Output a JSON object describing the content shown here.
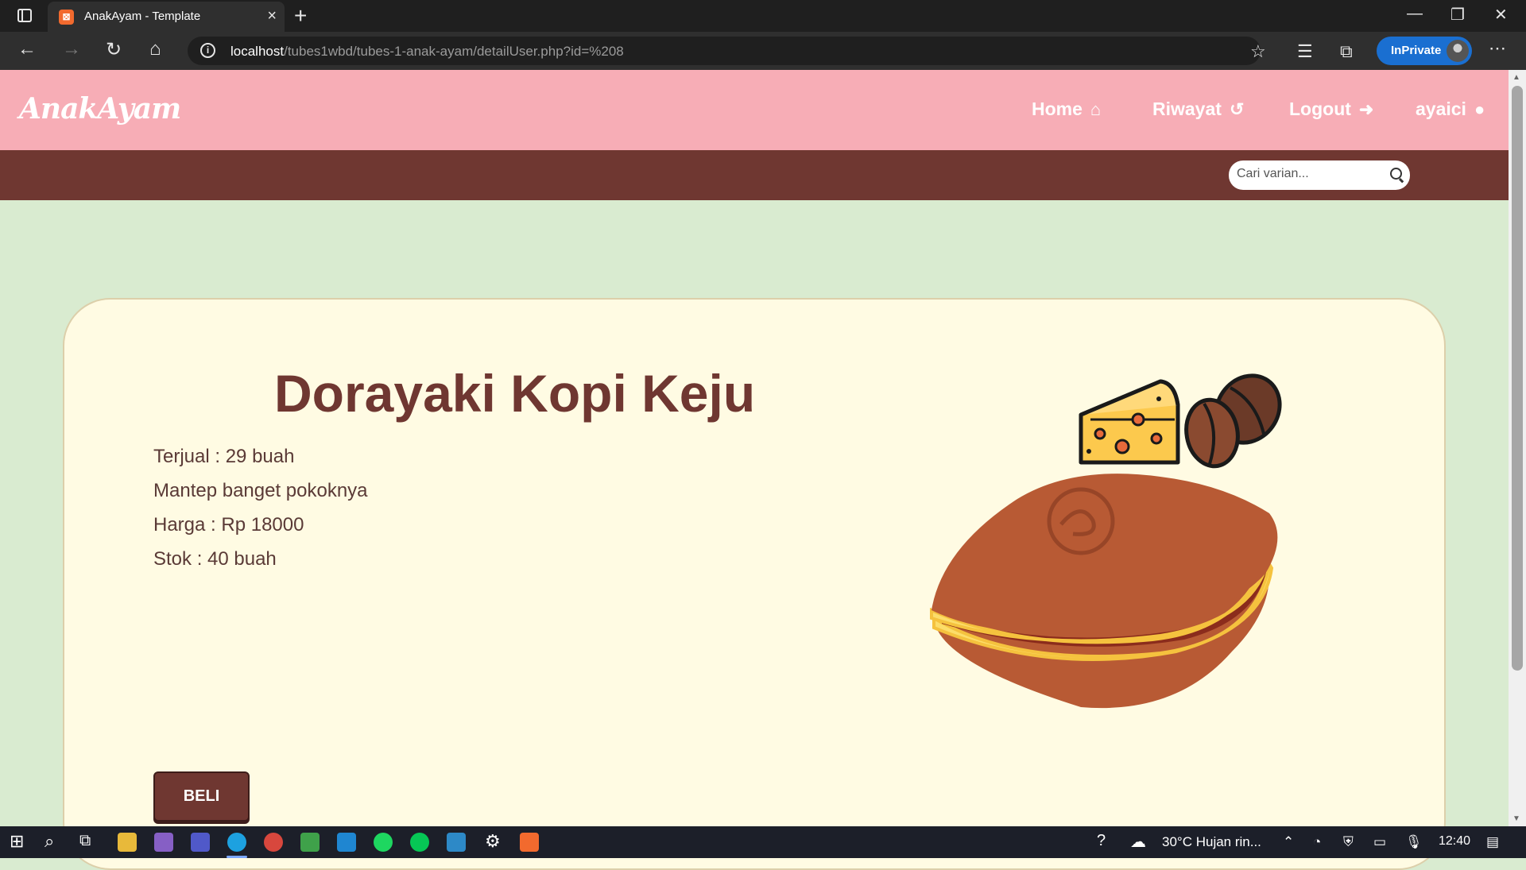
{
  "browser": {
    "tab_title": "AnakAyam - Template",
    "tab_favicon": "xampp-icon",
    "url_host": "localhost",
    "url_path": "/tubes1wbd/tubes-1-anak-ayam/detailUser.php?id=%208",
    "inprivate_label": "InPrivate"
  },
  "site": {
    "logo": "AnakAyam",
    "nav": [
      {
        "label": "Home",
        "icon": "home-icon"
      },
      {
        "label": "Riwayat",
        "icon": "history-icon"
      },
      {
        "label": "Logout",
        "icon": "logout-icon"
      },
      {
        "label": "ayaici",
        "icon": "user-icon"
      }
    ],
    "search_placeholder": "Cari varian...",
    "colors": {
      "header": "#f7adb6",
      "subbar": "#6f3731",
      "background": "#d9ebd0",
      "card": "#fffbe3"
    }
  },
  "product": {
    "title": "Dorayaki Kopi Keju",
    "sold": "Terjual : 29 buah",
    "description": "Mantep banget pokoknya",
    "price": "Harga : Rp 18000",
    "stock": "Stok : 40 buah",
    "buy_label": "BELI"
  },
  "taskbar": {
    "weather": "30°C  Hujan rin...",
    "time": "12:40"
  }
}
